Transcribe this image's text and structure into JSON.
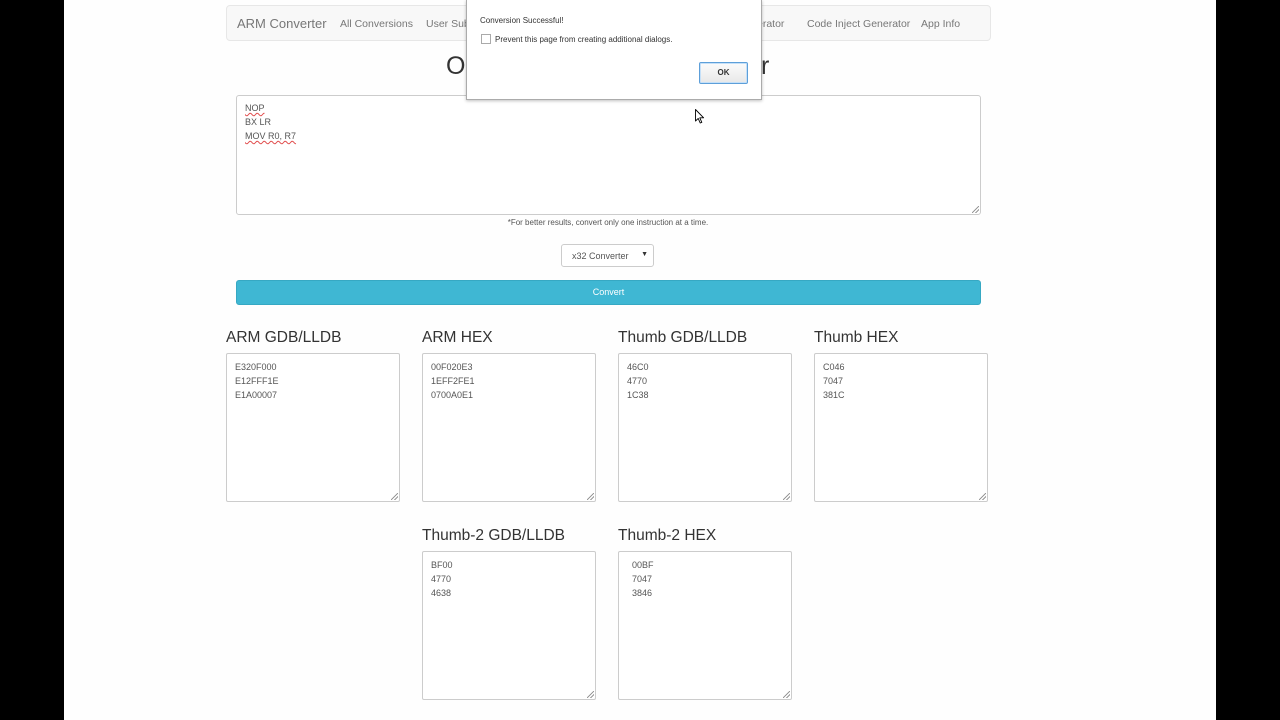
{
  "navbar": {
    "brand": "ARM Converter",
    "links": [
      "All Conversions",
      "User Sub",
      "erator",
      "Code Inject Generator",
      "App Info"
    ]
  },
  "heading": {
    "left_fragment": "O",
    "right_fragment": "r"
  },
  "editor": {
    "lines": [
      "NOP",
      "BX LR",
      "MOV R0, R7"
    ],
    "hint": "*For better results, convert only one instruction at a time."
  },
  "converter_select": {
    "selected": "x32 Converter"
  },
  "convert_button": "Convert",
  "panels": [
    {
      "title": "ARM GDB/LLDB",
      "lines": [
        "E320F000",
        "E12FFF1E",
        "E1A00007"
      ]
    },
    {
      "title": "ARM HEX",
      "lines": [
        "00F020E3",
        "1EFF2FE1",
        "0700A0E1"
      ]
    },
    {
      "title": "Thumb GDB/LLDB",
      "lines": [
        "46C0",
        "4770",
        "1C38"
      ]
    },
    {
      "title": "Thumb HEX",
      "lines": [
        "C046",
        "7047",
        "381C"
      ]
    },
    {
      "title": "Thumb-2 GDB/LLDB",
      "lines": [
        "BF00",
        "4770",
        "4638"
      ]
    },
    {
      "title": "Thumb-2 HEX",
      "lines": [
        "  00BF",
        "  7047",
        "  3846"
      ]
    }
  ],
  "dialog": {
    "message": "Conversion Successful!",
    "checkbox_label": "Prevent this page from creating additional dialogs.",
    "ok_label": "OK"
  },
  "colors": {
    "accent": "#3fb7d3",
    "page_bg": "#fefefe",
    "frame_bg": "#000000"
  }
}
